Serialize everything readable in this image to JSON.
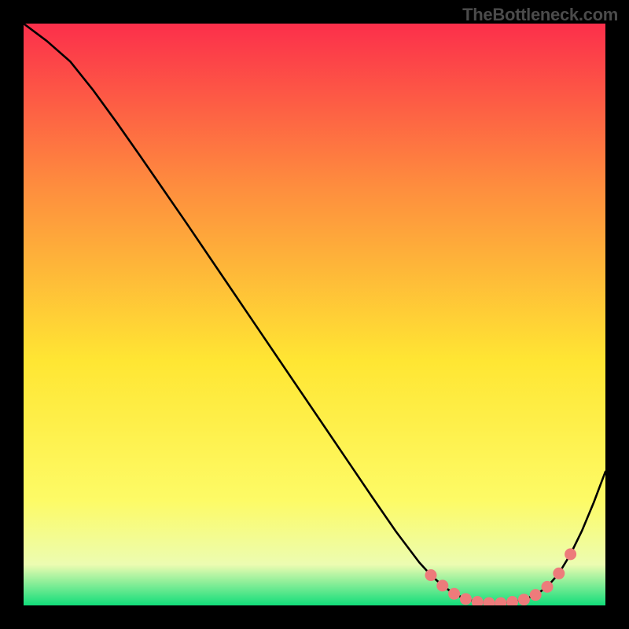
{
  "watermark": "TheBottleneck.com",
  "chart_data": {
    "type": "line",
    "title": "",
    "xlabel": "",
    "ylabel": "",
    "xlim": [
      0,
      100
    ],
    "ylim": [
      0,
      100
    ],
    "x": [
      0,
      4,
      8,
      12,
      16,
      20,
      24,
      28,
      32,
      36,
      40,
      44,
      48,
      52,
      56,
      60,
      64,
      68,
      70,
      72,
      74,
      76,
      78,
      80,
      82,
      84,
      86,
      88,
      90,
      92,
      94,
      96,
      98,
      100
    ],
    "y": [
      100,
      97,
      93.5,
      88.5,
      83,
      77.3,
      71.5,
      65.7,
      59.8,
      53.9,
      48,
      42.1,
      36.2,
      30.3,
      24.4,
      18.5,
      12.7,
      7.4,
      5.2,
      3.4,
      2.0,
      1.1,
      0.6,
      0.4,
      0.4,
      0.6,
      1.0,
      1.8,
      3.2,
      5.5,
      8.8,
      12.9,
      17.7,
      23.0
    ],
    "highlight_x": [
      70,
      72,
      74,
      76,
      78,
      80,
      82,
      84,
      86,
      88,
      90,
      92,
      94
    ],
    "highlight_y": [
      5.2,
      3.4,
      2.0,
      1.1,
      0.6,
      0.4,
      0.4,
      0.6,
      1.0,
      1.8,
      3.2,
      5.5,
      8.8
    ],
    "background_gradient": {
      "top": "#fc2f4b",
      "mid1": "#fe8d3e",
      "mid2": "#ffe633",
      "mid3": "#fdfb66",
      "mid4": "#ecfcb1",
      "bottom": "#12dd7a"
    }
  }
}
